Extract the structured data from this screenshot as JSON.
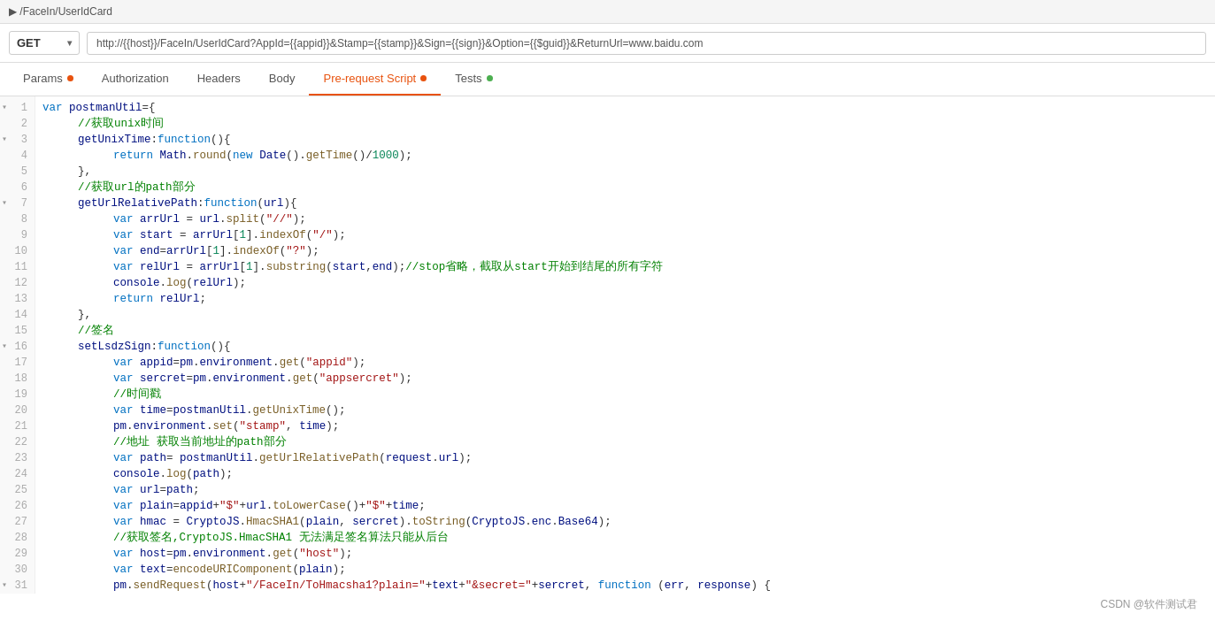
{
  "pathBar": {
    "text": "▶ /FaceIn/UserIdCard"
  },
  "requestBar": {
    "method": "GET",
    "url": "http://{{host}}/FaceIn/UserIdCard?AppId={{appid}}&Stamp={{stamp}}&Sign={{sign}}&Option={{$guid}}&ReturnUrl=www.baidu.com"
  },
  "tabs": [
    {
      "id": "params",
      "label": "Params",
      "dot": true,
      "dotColor": "orange",
      "active": false
    },
    {
      "id": "authorization",
      "label": "Authorization",
      "dot": false,
      "active": false
    },
    {
      "id": "headers",
      "label": "Headers",
      "dot": false,
      "active": false
    },
    {
      "id": "body",
      "label": "Body",
      "dot": false,
      "active": false
    },
    {
      "id": "prerequest",
      "label": "Pre-request Script",
      "dot": true,
      "dotColor": "orange",
      "active": true
    },
    {
      "id": "tests",
      "label": "Tests",
      "dot": true,
      "dotColor": "green",
      "active": false
    }
  ],
  "watermark": "CSDN @软件测试君"
}
